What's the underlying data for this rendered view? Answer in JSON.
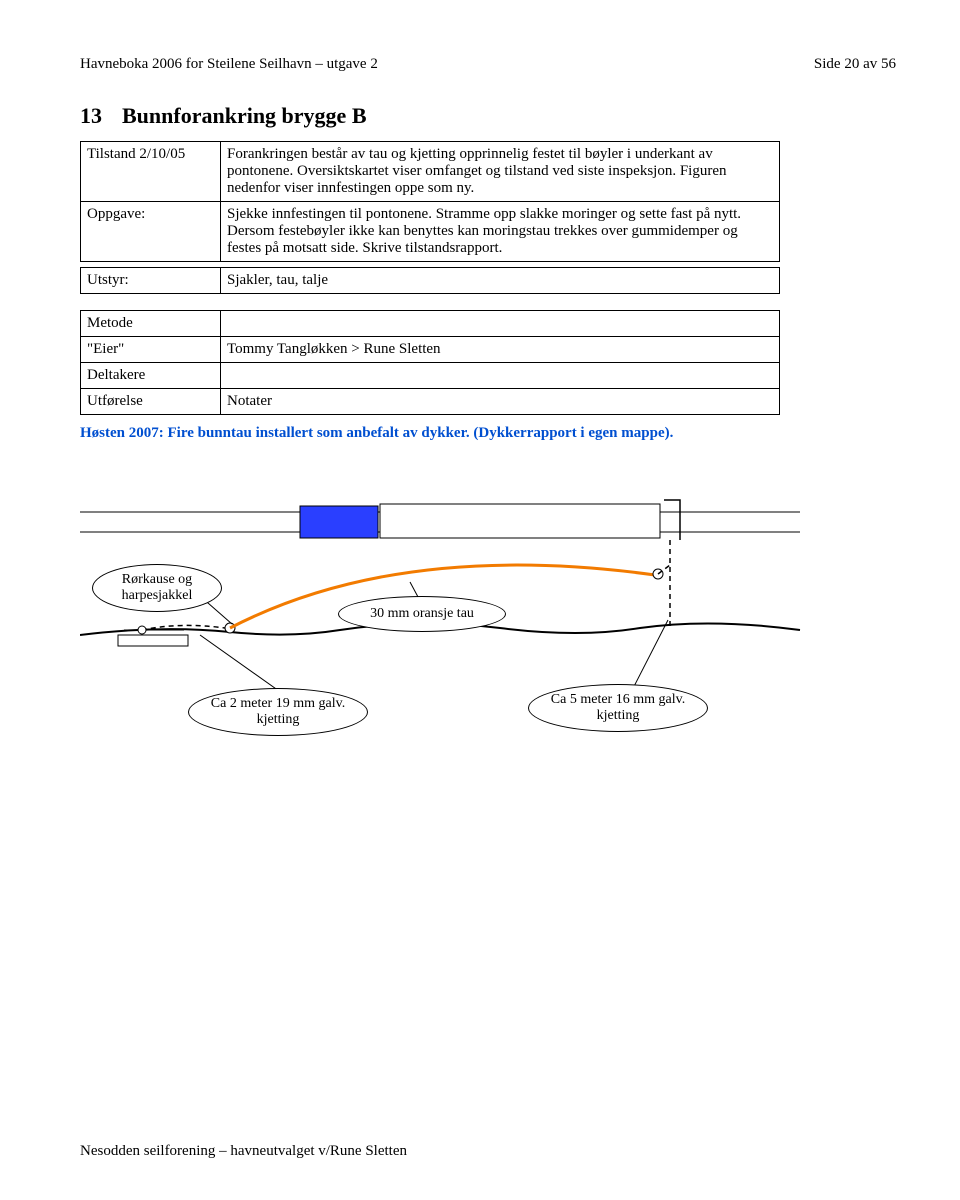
{
  "header": {
    "left": "Havneboka 2006 for Steilene Seilhavn – utgave 2",
    "right": "Side 20 av 56"
  },
  "title": {
    "num": "13",
    "text": "Bunnforankring brygge B"
  },
  "rows1": {
    "tilstand_label": "Tilstand 2/10/05",
    "tilstand_value": "Forankringen består av tau og kjetting opprinnelig festet til bøyler i underkant av pontonene. Oversiktskartet viser omfanget og tilstand ved siste inspeksjon. Figuren nedenfor viser innfestingen oppe som ny.",
    "oppgave_label": "Oppgave:",
    "oppgave_value": "Sjekke innfestingen til pontonene. Stramme opp slakke moringer og sette fast på nytt. Dersom festebøyler ikke kan benyttes kan moringstau trekkes over gummidemper og festes på motsatt side. Skrive tilstandsrapport.",
    "utstyr_label": "Utstyr:",
    "utstyr_value": "Sjakler, tau, talje"
  },
  "rows2": {
    "metode_label": "Metode",
    "metode_value": "",
    "eier_label": "\"Eier\"",
    "eier_value": "Tommy Tangløkken > Rune Sletten",
    "deltakere_label": "Deltakere",
    "deltakere_value": "",
    "utforelse_label": "Utførelse",
    "utforelse_value": "Notater"
  },
  "note": "Høsten 2007: Fire bunntau installert som anbefalt av dykker. (Dykkerrapport i egen mappe).",
  "diagram": {
    "rorkause": "Rørkause og harpesjakkel",
    "oransje": "30 mm oransje tau",
    "kjetting_left": "Ca 2 meter 19 mm galv. kjetting",
    "kjetting_right": "Ca 5 meter 16 mm galv. kjetting"
  },
  "footer": "Nesodden seilforening – havneutvalget v/Rune Sletten"
}
